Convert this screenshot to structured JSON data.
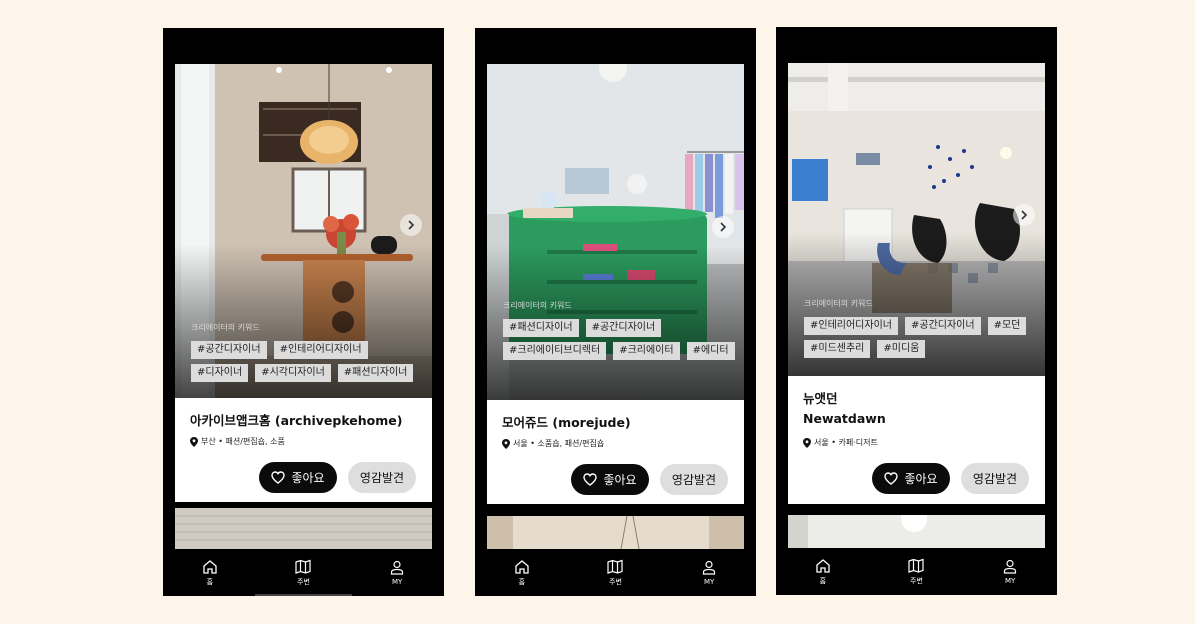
{
  "keyword_label": "크리에이터의 키워드",
  "buttons": {
    "like": "좋아요",
    "inspiration": "영감발견"
  },
  "tabs": [
    {
      "label": "홈",
      "icon": "home-icon"
    },
    {
      "label": "주변",
      "icon": "map-icon"
    },
    {
      "label": "MY",
      "icon": "user-icon"
    }
  ],
  "screens": [
    {
      "name": "아카이브앱크홈 (archivepkehome)",
      "location": "부산 • 패션/편집숍, 소품",
      "keywords": [
        "#공간디자이너",
        "#인테리어디자이너",
        "#디자이너",
        "#시각디자이너",
        "#패션디자이너"
      ]
    },
    {
      "name": "모어쥬드 (morejude)",
      "location": "서울 • 소품숍, 패션/편집숍",
      "keywords": [
        "#패션디자이너",
        "#공간디자이너",
        "#크리에이티브디렉터",
        "#크리에이터",
        "#에디터"
      ]
    },
    {
      "name_ko": "뉴앳던",
      "name": "Newatdawn",
      "location": "서울 • 카페·디저트",
      "keywords": [
        "#인테리어디자이너",
        "#공간디자이너",
        "#모던",
        "#미드센추리",
        "#미디움"
      ]
    }
  ]
}
